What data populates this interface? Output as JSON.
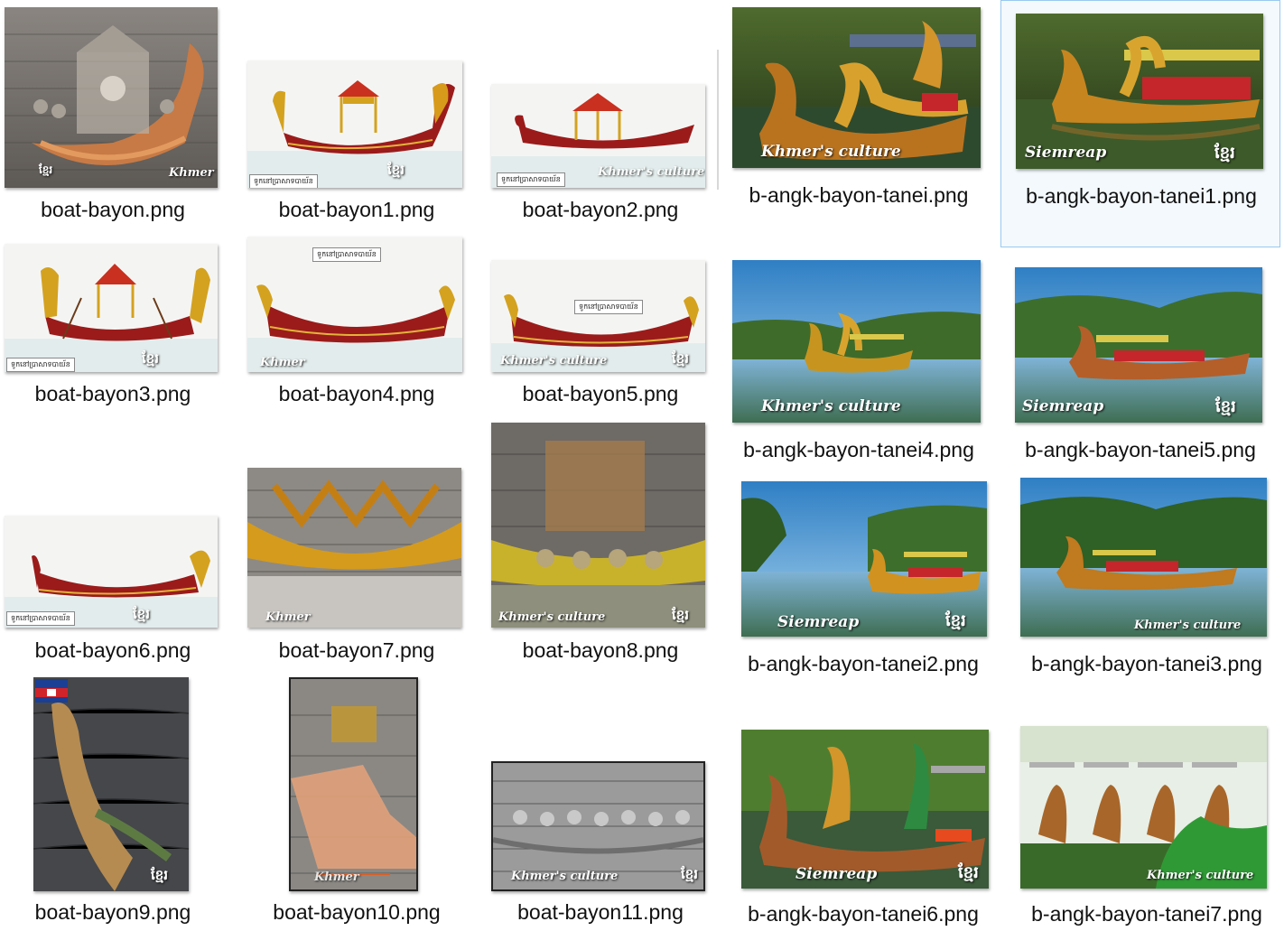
{
  "watermarks": {
    "khmer_culture": "Khmer's culture",
    "khmer": "Khmer",
    "siemreap": "Siemreap",
    "khmer_script": "ខ្មែរ",
    "bayon_label": "ទូកនៅប្រាសាទបាយ័ន"
  },
  "files": [
    {
      "name": "boat-bayon.png",
      "thumb": "relief-orange"
    },
    {
      "name": "boat-bayon1.png",
      "thumb": "drawn-boat-pavilion"
    },
    {
      "name": "boat-bayon2.png",
      "thumb": "drawn-boat-gate"
    },
    {
      "name": "b-angk-bayon-tanei.png",
      "thumb": "photo-lake-boats"
    },
    {
      "name": "b-angk-bayon-tanei1.png",
      "thumb": "photo-lake-boats",
      "selected": true
    },
    {
      "name": "boat-bayon3.png",
      "thumb": "drawn-boat-pavilion"
    },
    {
      "name": "boat-bayon4.png",
      "thumb": "drawn-boat-plain"
    },
    {
      "name": "boat-bayon5.png",
      "thumb": "drawn-boat-plain"
    },
    {
      "name": "b-angk-bayon-tanei4.png",
      "thumb": "photo-lake-forest"
    },
    {
      "name": "b-angk-bayon-tanei5.png",
      "thumb": "photo-lake-forest"
    },
    {
      "name": "boat-bayon6.png",
      "thumb": "drawn-boat-plain"
    },
    {
      "name": "boat-bayon7.png",
      "thumb": "relief-gold"
    },
    {
      "name": "boat-bayon8.png",
      "thumb": "relief-gold"
    },
    {
      "name": "b-angk-bayon-tanei2.png",
      "thumb": "photo-lake-forest"
    },
    {
      "name": "b-angk-bayon-tanei3.png",
      "thumb": "photo-lake-forest"
    },
    {
      "name": "boat-bayon9.png",
      "thumb": "relief-dark-flag"
    },
    {
      "name": "boat-bayon10.png",
      "thumb": "relief-grey-orange"
    },
    {
      "name": "boat-bayon11.png",
      "thumb": "relief-grey"
    },
    {
      "name": "b-angk-bayon-tanei6.png",
      "thumb": "photo-lake-boats"
    },
    {
      "name": "b-angk-bayon-tanei7.png",
      "thumb": "photo-lake-boats"
    }
  ]
}
